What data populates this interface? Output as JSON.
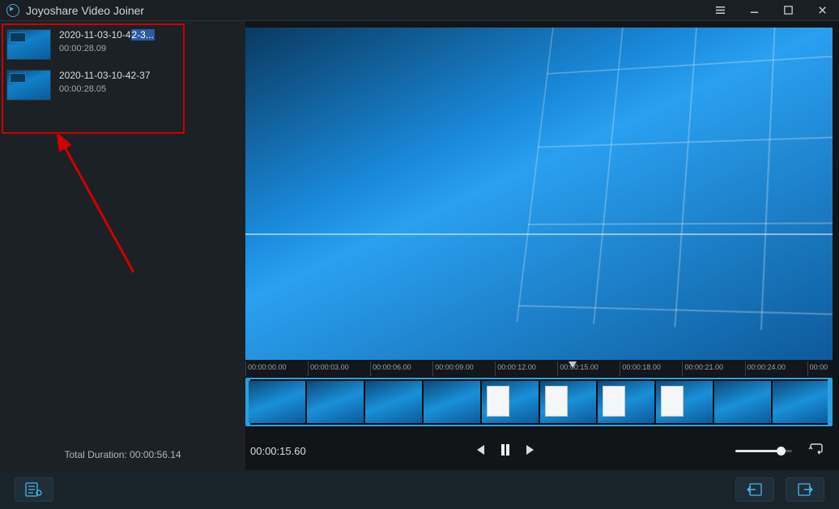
{
  "app": {
    "title": "Joyoshare Video Joiner"
  },
  "clips": [
    {
      "name_pre": "2020-11-03-10-4",
      "name_hl": "2-3...",
      "duration": "00:00:28.09"
    },
    {
      "name_pre": "2020-11-03-10-42-37",
      "name_hl": "",
      "duration": "00:00:28.05"
    }
  ],
  "total_label": "Total Duration: ",
  "total_value": "00:00:56.14",
  "ruler": [
    "00:00:00.00",
    "00:00:03.00",
    "00:00:06.00",
    "00:00:09.00",
    "00:00:12.00",
    "00:00:15.00",
    "00:00:18.00",
    "00:00:21.00",
    "00:00:24.00",
    "00:00"
  ],
  "playback": {
    "current": "00:00:15.60"
  },
  "colors": {
    "accent": "#2aa0e0",
    "highlight_box": "#cc0000"
  }
}
